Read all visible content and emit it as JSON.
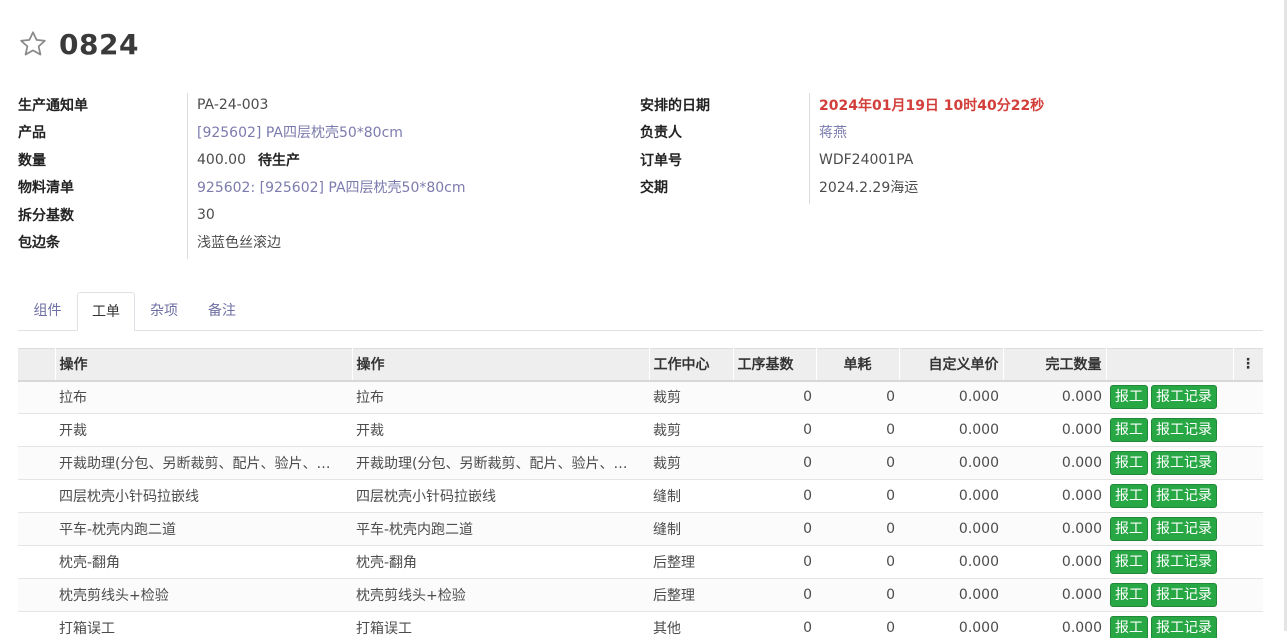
{
  "record": {
    "title": "0824"
  },
  "left_fields": [
    {
      "label": "生产通知单",
      "value": "PA-24-003",
      "style": "plain"
    },
    {
      "label": "产品",
      "value": "[925602] PA四层枕壳50*80cm",
      "style": "link"
    },
    {
      "label": "数量",
      "value": "400.00",
      "extra": "待生产",
      "style": "plain"
    },
    {
      "label": "物料清单",
      "value": "925602: [925602] PA四层枕壳50*80cm",
      "style": "link"
    },
    {
      "label": "拆分基数",
      "value": "30",
      "style": "plain"
    },
    {
      "label": "包边条",
      "value": "浅蓝色丝滚边",
      "style": "plain"
    }
  ],
  "right_fields": [
    {
      "label": "安排的日期",
      "value": "2024年01月19日 10时40分22秒",
      "style": "red"
    },
    {
      "label": "负责人",
      "value": "蒋燕",
      "style": "link"
    },
    {
      "label": "订单号",
      "value": "WDF24001PA",
      "style": "plain"
    },
    {
      "label": "交期",
      "value": "2024.2.29海运",
      "style": "plain"
    }
  ],
  "tabs": [
    {
      "label": "组件",
      "active": false
    },
    {
      "label": "工单",
      "active": true
    },
    {
      "label": "杂项",
      "active": false
    },
    {
      "label": "备注",
      "active": false
    }
  ],
  "table": {
    "headers": [
      "操作",
      "操作",
      "工作中心",
      "工序基数",
      "单耗",
      "自定义单价",
      "完工数量"
    ],
    "kebab": "⋮",
    "report_label": "报工",
    "record_label": "报工记录",
    "rows": [
      {
        "op": "拉布",
        "op2": "拉布",
        "wc": "裁剪",
        "base": "0",
        "unit": "0",
        "price": "0.000",
        "done": "0.000"
      },
      {
        "op": "开裁",
        "op2": "开裁",
        "wc": "裁剪",
        "base": "0",
        "unit": "0",
        "price": "0.000",
        "done": "0.000"
      },
      {
        "op": "开裁助理(分包、另断裁剪、配片、验片、…",
        "op2": "开裁助理(分包、另断裁剪、配片、验片、…",
        "wc": "裁剪",
        "base": "0",
        "unit": "0",
        "price": "0.000",
        "done": "0.000"
      },
      {
        "op": "四层枕壳小针码拉嵌线",
        "op2": "四层枕壳小针码拉嵌线",
        "wc": "缝制",
        "base": "0",
        "unit": "0",
        "price": "0.000",
        "done": "0.000"
      },
      {
        "op": "平车-枕壳内跑二道",
        "op2": "平车-枕壳内跑二道",
        "wc": "缝制",
        "base": "0",
        "unit": "0",
        "price": "0.000",
        "done": "0.000"
      },
      {
        "op": "枕壳-翻角",
        "op2": "枕壳-翻角",
        "wc": "后整理",
        "base": "0",
        "unit": "0",
        "price": "0.000",
        "done": "0.000"
      },
      {
        "op": "枕壳剪线头+检验",
        "op2": "枕壳剪线头+检验",
        "wc": "后整理",
        "base": "0",
        "unit": "0",
        "price": "0.000",
        "done": "0.000"
      },
      {
        "op": "打箱误工",
        "op2": "打箱误工",
        "wc": "其他",
        "base": "0",
        "unit": "0",
        "price": "0.000",
        "done": "0.000"
      }
    ]
  }
}
